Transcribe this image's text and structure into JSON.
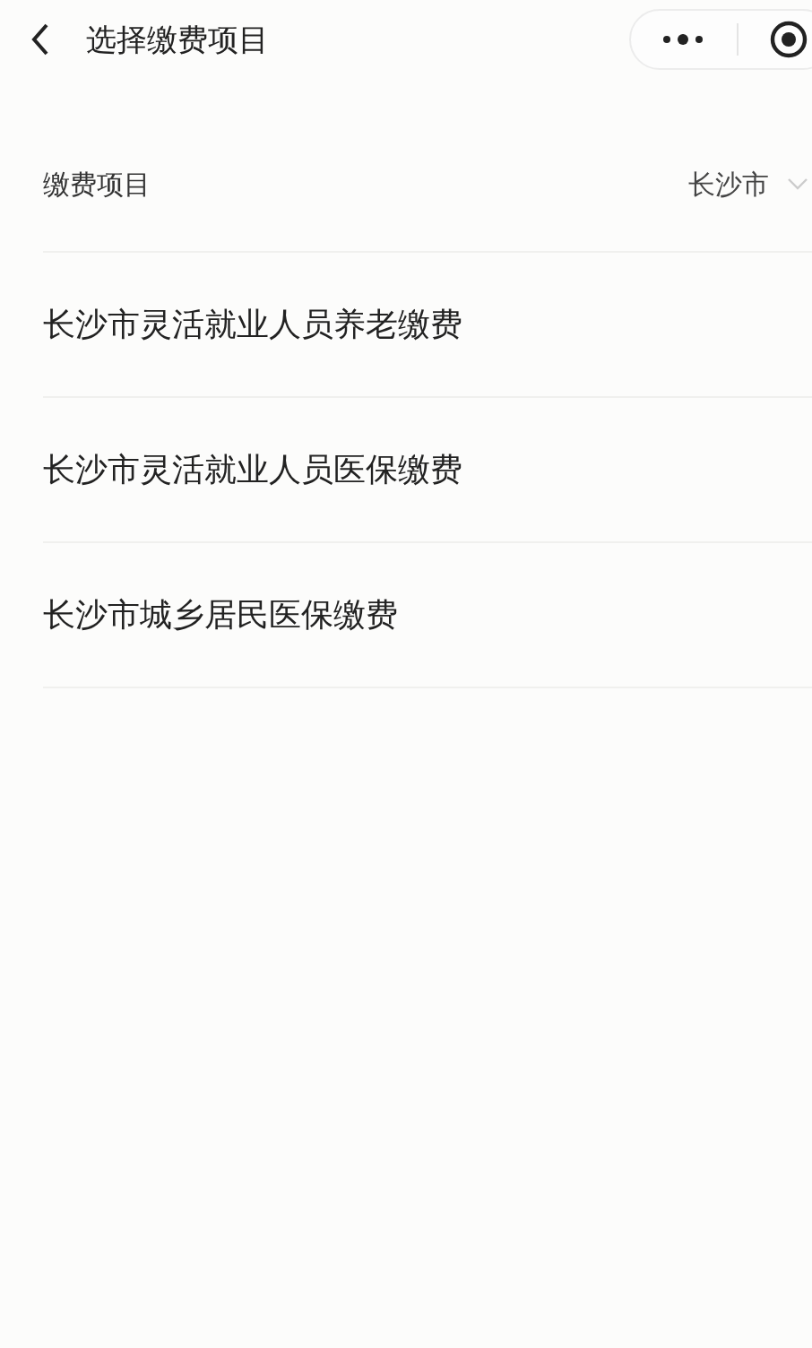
{
  "nav_bar": {
    "title": "选择缴费项目"
  },
  "filter": {
    "label": "缴费项目",
    "city": "长沙市"
  },
  "items": [
    {
      "label": "长沙市灵活就业人员养老缴费"
    },
    {
      "label": "长沙市灵活就业人员医保缴费"
    },
    {
      "label": "长沙市城乡居民医保缴费"
    }
  ]
}
